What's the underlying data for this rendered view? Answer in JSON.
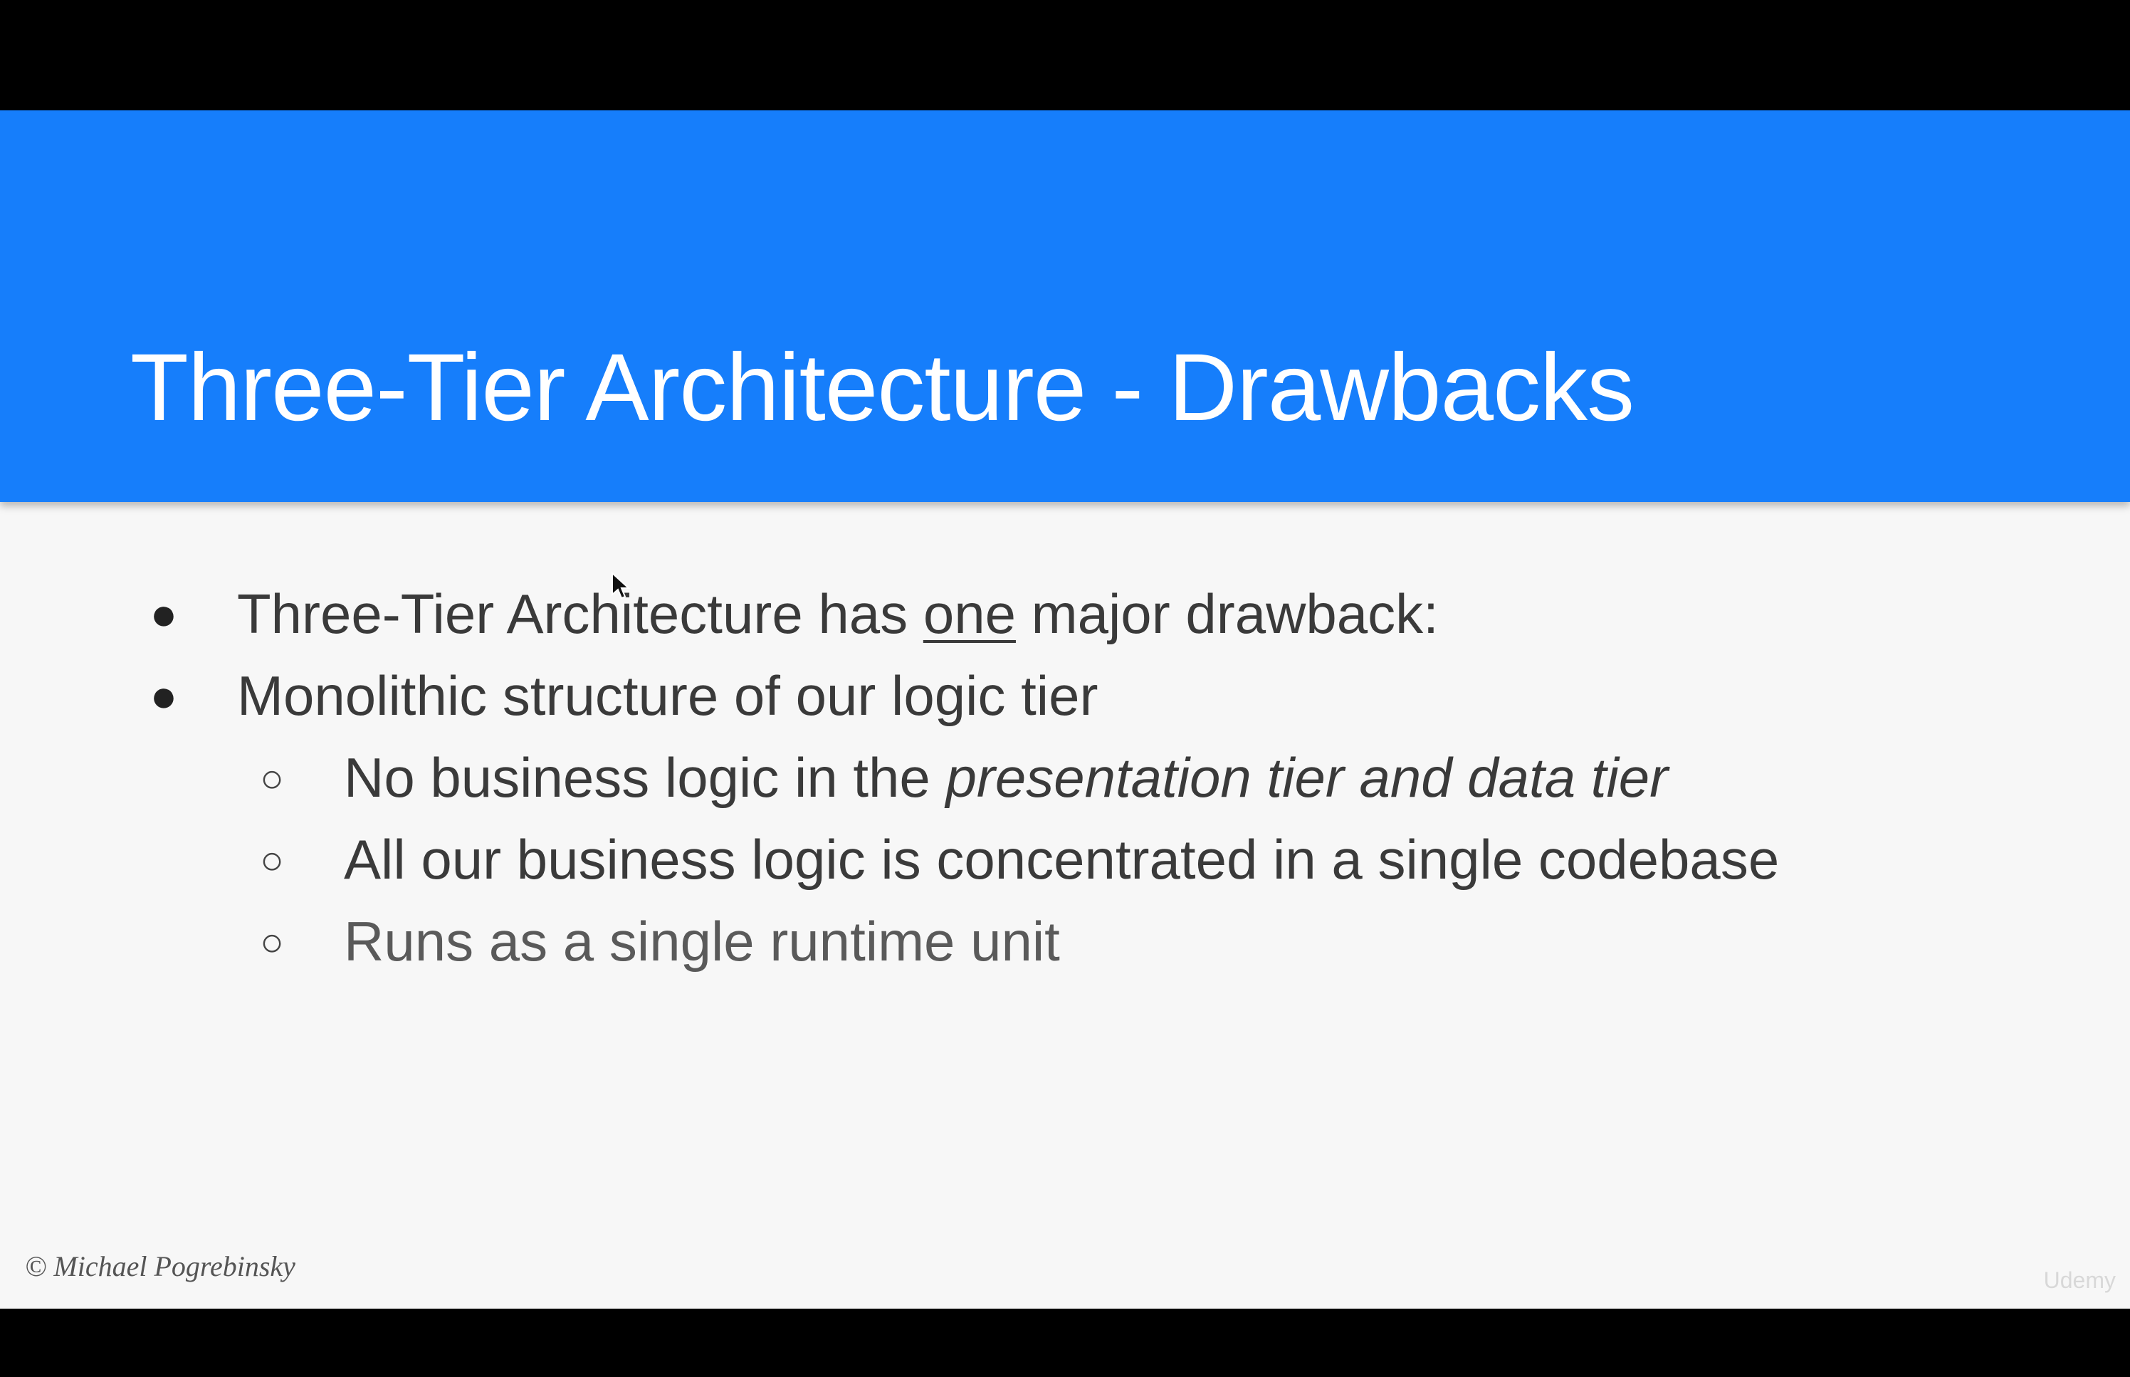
{
  "slide": {
    "title": "Three-Tier Architecture - Drawbacks",
    "bullets": [
      {
        "before": "Three-Tier Architecture has ",
        "emphasis": "one",
        "after": " major drawback:"
      },
      {
        "text": "Monolithic structure of our logic tier",
        "sub": [
          {
            "before": "No business logic in the ",
            "italic": "presentation tier and data tier"
          },
          {
            "text": "All our business logic is concentrated in a single codebase"
          },
          {
            "text": "Runs as a single runtime unit"
          }
        ]
      }
    ],
    "copyright": "© Michael Pogrebinsky",
    "watermark": "Udemy"
  },
  "colors": {
    "header": "#167efb",
    "background": "#f7f7f7",
    "letterbox": "#000000",
    "title_text": "#ffffff",
    "body_text": "#3a3a3a"
  },
  "icons": {
    "bullet_level1": "filled-circle",
    "bullet_level2": "hollow-circle",
    "pointer": "mouse-cursor-icon"
  }
}
